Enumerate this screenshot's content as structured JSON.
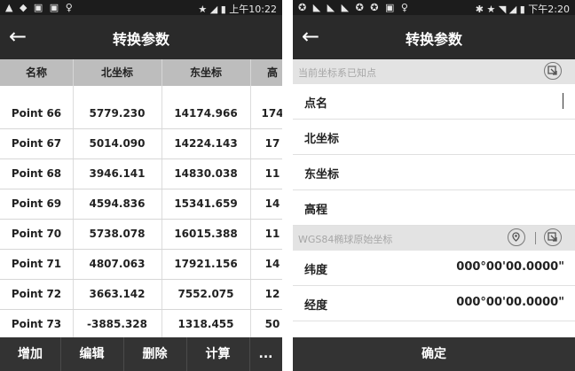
{
  "left": {
    "status": {
      "icons": "▲ ◆ ▣ ▣ ♀",
      "right": "★ ◢ ▮ 上午10:22"
    },
    "title": "转换参数",
    "columns": [
      "名称",
      "北坐标",
      "东坐标",
      "高"
    ],
    "rows": [
      {
        "name": "Point 66",
        "north": "5779.230",
        "east": "14174.966",
        "height": "174"
      },
      {
        "name": "Point 67",
        "north": "5014.090",
        "east": "14224.143",
        "height": "17"
      },
      {
        "name": "Point 68",
        "north": "3946.141",
        "east": "14830.038",
        "height": "11"
      },
      {
        "name": "Point 69",
        "north": "4594.836",
        "east": "15341.659",
        "height": "14"
      },
      {
        "name": "Point 70",
        "north": "5738.078",
        "east": "16015.388",
        "height": "11"
      },
      {
        "name": "Point 71",
        "north": "4807.063",
        "east": "17921.156",
        "height": "14"
      },
      {
        "name": "Point 72",
        "north": "3663.142",
        "east": "7552.075",
        "height": "12"
      },
      {
        "name": "Point 73",
        "north": "-3885.328",
        "east": "1318.455",
        "height": "50"
      }
    ],
    "actions": {
      "add": "增加",
      "edit": "编辑",
      "delete": "删除",
      "calc": "计算",
      "more": "..."
    }
  },
  "right": {
    "status": {
      "icons": "✪ ◣ ◣ ◣ ✪ ✪ ▣ ♀",
      "right": "✱ ★ ◥ ◢ ▮ 下午2:20"
    },
    "title": "转换参数",
    "section1": "当前坐标系已知点",
    "fields1": {
      "name": "点名",
      "north": "北坐标",
      "east": "东坐标",
      "height": "高程"
    },
    "section2": "WGS84椭球原始坐标",
    "fields2": {
      "lat_label": "纬度",
      "lat_value": "000°00'00.0000\"",
      "lon_label": "经度",
      "lon_value": "000°00'00.0000\""
    },
    "confirm": "确定"
  }
}
